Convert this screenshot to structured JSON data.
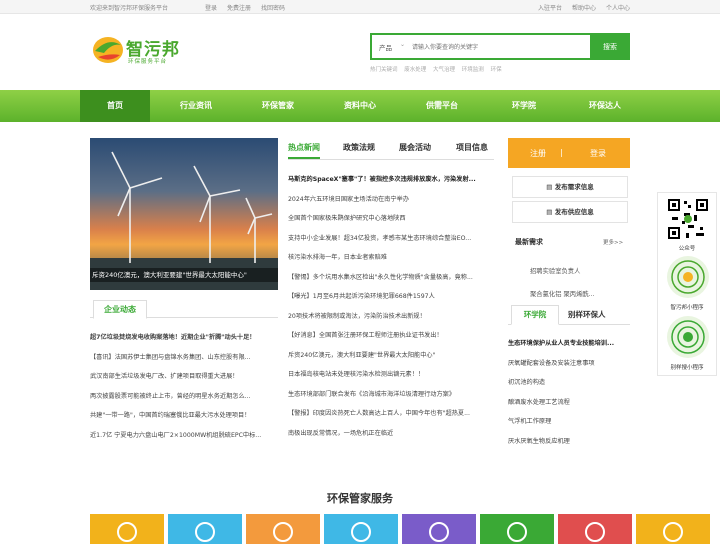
{
  "topbar": {
    "welcome": "欢迎来到智污邦环保服务平台",
    "login": "登录",
    "register": "免费注册",
    "forgot": "找回密码",
    "entry": "入驻平台",
    "help": "帮助中心",
    "personal": "个人中心"
  },
  "logo": {
    "name": "智污邦",
    "slogan": "环保服务平台"
  },
  "search": {
    "category": "产品",
    "placeholder": "请输入你要查询的关键字",
    "button": "搜索",
    "hot_label": "热门关键词",
    "hot": [
      "废水处理",
      "大气治理",
      "环境监测",
      "环保"
    ]
  },
  "nav": [
    "首页",
    "行业资讯",
    "环保管家",
    "资料中心",
    "供需平台",
    "环学院",
    "环保达人"
  ],
  "banner": {
    "caption": "斥资240亿澳元，澳大利亚要建\"世界最大太阳能中心\""
  },
  "news_tabs": [
    "热点新闻",
    "政策法规",
    "展会活动",
    "项目信息"
  ],
  "news": [
    "马斯克的SpaceX\"塞事\"了！被指控多次违规排放废水，污染发射...",
    "2024年六五环境日国家主场活动在南宁举办",
    "全国首个国家极朱鹮保护研究中心落地陕西",
    "支持中小企业发展！超34亿投资，孝感市某生态环境综合整治EO...",
    "核污染水排海一年，日本业者索赔难",
    "【警惕】多个坑用水集水区检出\"永久性化学物质\"含量极高，竟称...",
    "【曝光】1月至6月共起诉污染环境犯罪668件1597人",
    "20项技术将被限制或淘汰，污染防治技术出新规！",
    "【好消息】全国首张注册环保工程师注册执业证书发出！",
    "斥资240亿澳元，澳大利亚要建\"世界最大太阳能中心\"",
    "日本福岛核电站未处理核污染水检测出镝元素！！",
    "生态环境部部门联合发布《沿海城市海洋垃圾清理行动方案》",
    "【警报】印度因炎热死亡人数高达上百人，中国今年也有\"超热夏...",
    "南极出现反常情况，一场危机正在临近"
  ],
  "company": {
    "title": "企业动态",
    "items": [
      "超7亿垃圾焚烧发电收购案落地！近期企业\"折腾\"动头十足！",
      "【喜讯】法国苏伊士集团与盘锦水务集团、山东控股有限...",
      "武汉南部生活垃圾发电厂改、扩建项目取得重大进展！",
      "两次披露股票可能被终止上市，曾经的明星水务近期怎么...",
      "共建\"一带一路\"，中国首约瑞塞俄比亚最大污水处理项目！",
      "近1.7亿 宁夏电力六盘山电厂2×1000MW机组脱硫EPC中标..."
    ]
  },
  "account": {
    "register": "注册",
    "login": "登录"
  },
  "publish": {
    "demand": "发布需求信息",
    "supply": "发布供应信息"
  },
  "latest": {
    "title": "最新需求",
    "more": "更多>>",
    "items": [
      "招聘实验室负责人",
      "聚合氯化铝 聚丙烯酰..."
    ]
  },
  "school": {
    "tabs": [
      "环学院",
      "别样环保人"
    ],
    "items": [
      "生态环境保护从业人员专业技能培训...",
      "厌氧罐配套设备及安装注意事项",
      "初沉池的构造",
      "酿酒废水处理工艺流程",
      "气浮机工作原理",
      "厌水厌氧生物反应机理"
    ]
  },
  "qr": {
    "official": "公众号",
    "miniprogram": "智污邦小程序",
    "miniprogram2": "别样搜小程序"
  },
  "service": {
    "title": "环保管家服务",
    "colors": [
      "#f2b21b",
      "#3fb8e6",
      "#f39a3d",
      "#3fb8e6",
      "#7a5cc9",
      "#3aa935",
      "#e04e4e",
      "#f2b21b"
    ]
  }
}
